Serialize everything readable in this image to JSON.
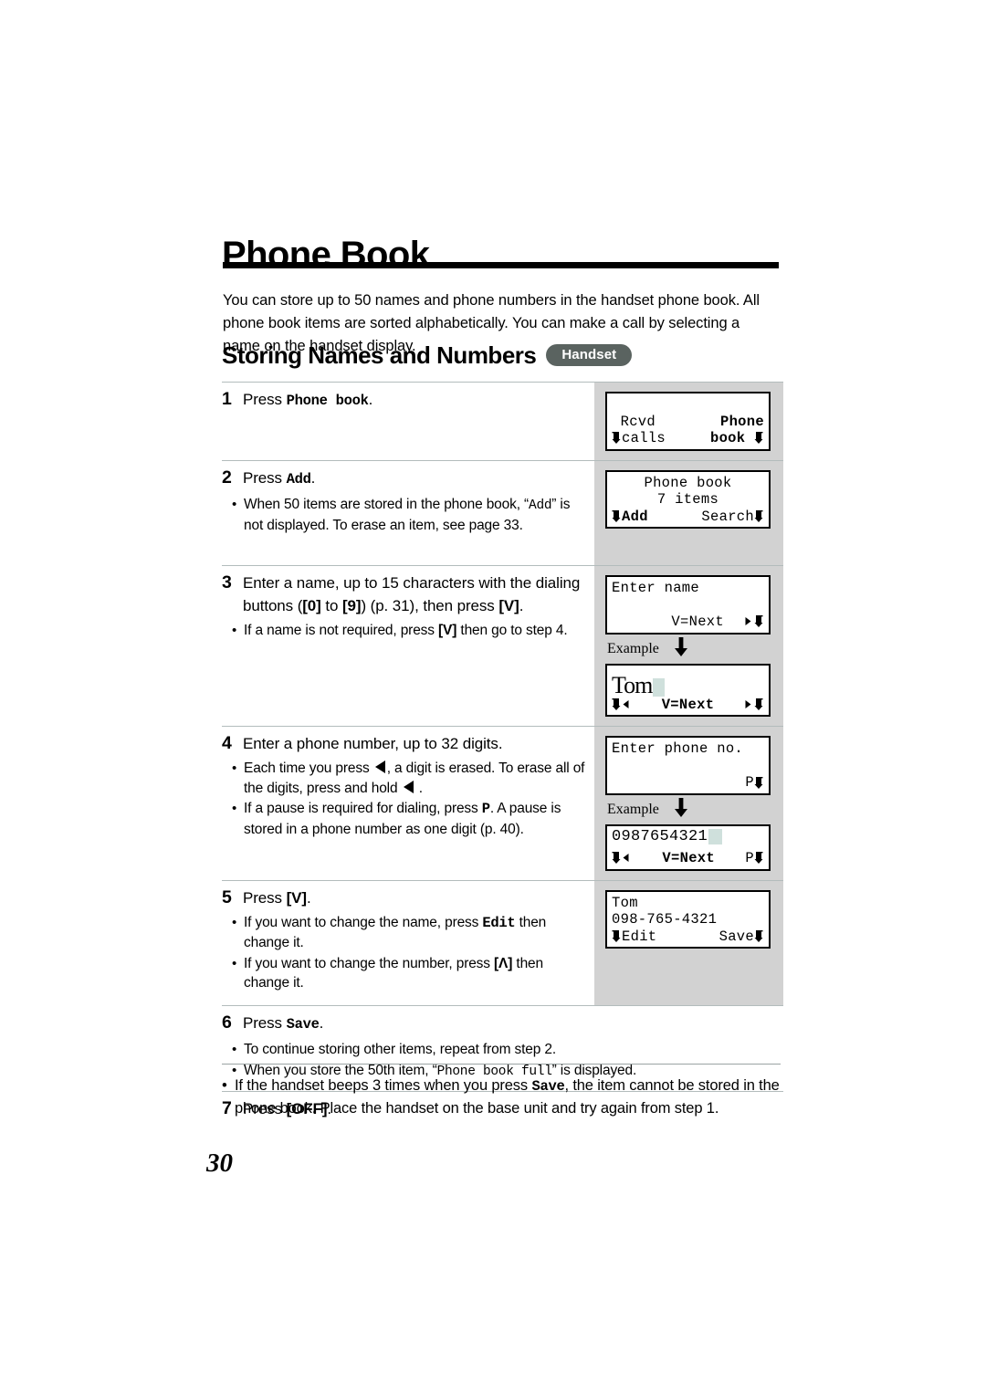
{
  "page": {
    "title": "Phone Book",
    "intro": "You can store up to 50 names and phone numbers in the handset phone book. All phone book items are sorted alphabetically. You can make a call by selecting a name on the handset display.",
    "section_title": "Storing Names and Numbers",
    "badge": "Handset",
    "page_number": "30",
    "example_label": "Example",
    "accent_badge_color": "#5a6360",
    "panel_color": "#d2d2d2"
  },
  "steps": [
    {
      "num": "1",
      "text_pre": "Press ",
      "text_mono": "Phone book",
      "text_post": ".",
      "bullets": []
    },
    {
      "num": "2",
      "text_pre": "Press ",
      "text_mono": "Add",
      "text_post": ".",
      "bullets": [
        {
          "pre": "When 50 items are stored in the phone book, “",
          "mono": "Add",
          "post": "” is not displayed. To erase an item, see page 33."
        }
      ]
    },
    {
      "num": "3",
      "text_full_a": "Enter a name, up to 15 characters with the dialing buttons (",
      "key_0": "[0]",
      "text_full_b": " to ",
      "key_9": "[9]",
      "text_full_c": ") (p. 31), then press ",
      "key_down": "[V]",
      "text_full_d": ".",
      "bullets": [
        {
          "pre": "If a name is not required, press ",
          "key": "[V]",
          "post": " then go to step 4."
        }
      ]
    },
    {
      "num": "4",
      "text_plain": "Enter a phone number, up to 32 digits.",
      "bullets": [
        {
          "pre": "Each time you press ",
          "icon": "left-triangle-icon",
          "mid": ", a digit is erased. To erase all of the digits, press and hold ",
          "icon2": "left-triangle-icon",
          "post": " ."
        },
        {
          "pre": "If a pause is required for dialing, press ",
          "mono": "P",
          "post": ". A pause is stored in a phone number as one digit (p. 40)."
        }
      ]
    },
    {
      "num": "5",
      "text_pre": "Press ",
      "key_down": "[V]",
      "text_post": ".",
      "bullets": [
        {
          "pre": "If you want to change the name, press ",
          "mono": "Edit",
          "post": " then change it."
        },
        {
          "pre": "If you want to change the number, press ",
          "key": "[Λ]",
          "post": " then change it."
        }
      ]
    },
    {
      "num": "6",
      "text_pre": "Press ",
      "text_mono": "Save",
      "text_post": ".",
      "bullets": [
        {
          "plain": "To continue storing other items, repeat from step 2."
        },
        {
          "pre": "When you store the 50th item, “",
          "mono": "Phone book full",
          "post": "” is displayed."
        }
      ]
    },
    {
      "num": "7",
      "text_pre": "Press ",
      "key_off": "[OFF]",
      "text_post": "."
    }
  ],
  "lcd": {
    "step1": {
      "line1_left": " Rcvd",
      "line1_right": "Phone",
      "line2_left": "calls",
      "line2_right": "book"
    },
    "step2": {
      "line1": "Phone book",
      "line2": "7 items",
      "softkey_left": "Add",
      "softkey_right": "Search"
    },
    "step3a": {
      "line1": "Enter name",
      "line3": "V=Next"
    },
    "step3b": {
      "name": "Tom",
      "softkey_center": "V=Next"
    },
    "step4a": {
      "line1": "Enter phone no.",
      "softkey_right": "P"
    },
    "step4b": {
      "number": "0987654321",
      "softkey_center": "V=Next",
      "softkey_right": "P"
    },
    "step5": {
      "line1": "Tom",
      "line2": "098-765-4321",
      "softkey_left": "Edit",
      "softkey_right": "Save"
    }
  },
  "footnote": {
    "pre": "If the handset beeps 3 times when you press ",
    "mono": "Save",
    "post": ", the item cannot be stored in the phone book. Place the handset on the base unit and try again from step 1."
  }
}
